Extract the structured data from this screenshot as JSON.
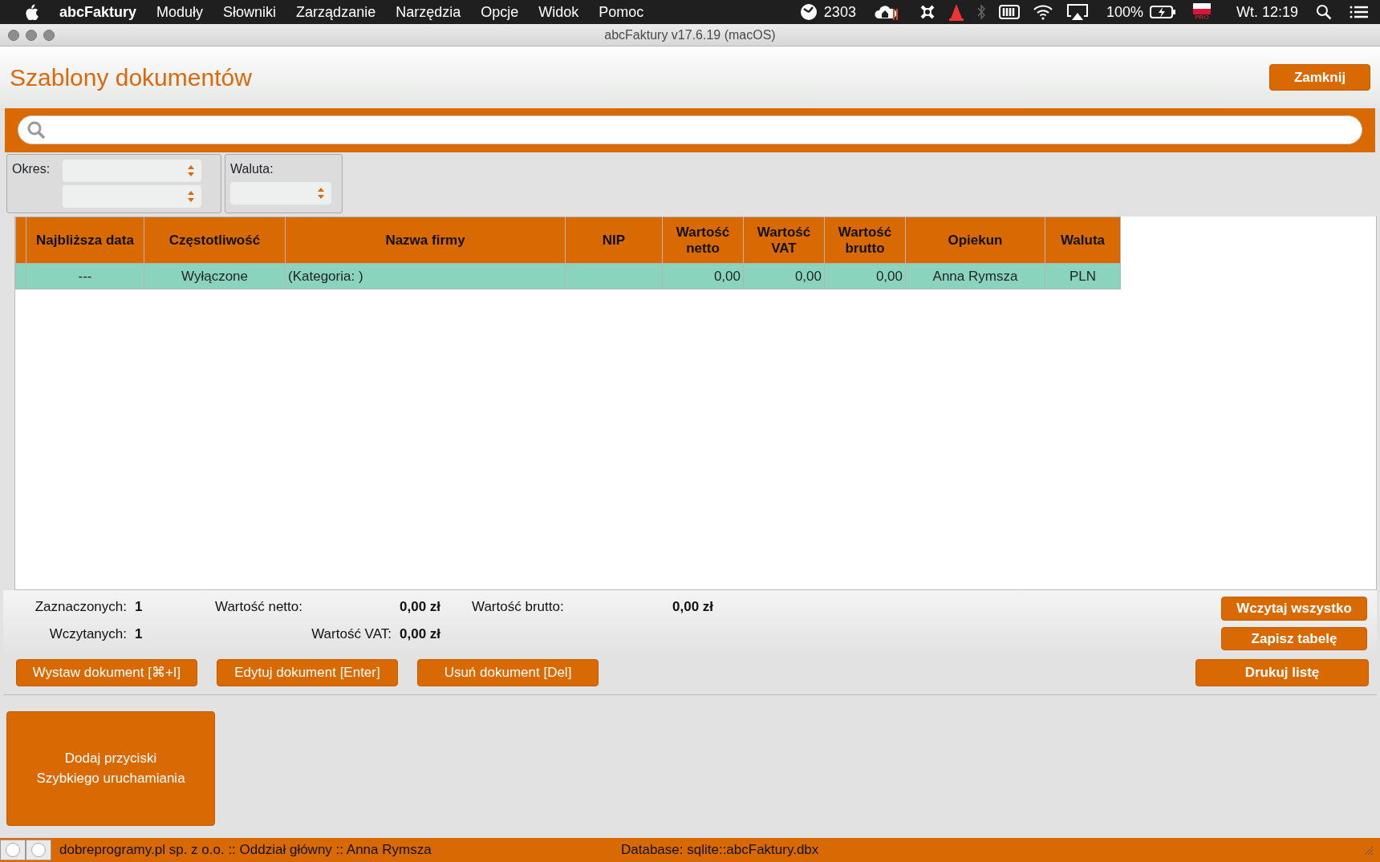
{
  "menu_bar": {
    "app_name": "abcFaktury",
    "items": [
      "Moduły",
      "Słowniki",
      "Zarządzanie",
      "Narzędzia",
      "Opcje",
      "Widok",
      "Pomoc"
    ],
    "timer_count": "2303",
    "flag_badge": "PRO",
    "battery": "100%",
    "clock": "Wt. 12:19"
  },
  "window": {
    "title": "abcFaktury v17.6.19 (macOS)"
  },
  "header": {
    "title": "Szablony dokumentów",
    "close_button": "Zamknij"
  },
  "filters": {
    "period_label": "Okres:",
    "currency_label": "Waluta:"
  },
  "table": {
    "columns": [
      "Najbliższa data",
      "Częstotliwość",
      "Nazwa firmy",
      "NIP",
      "Wartość netto",
      "Wartość VAT",
      "Wartość brutto",
      "Opiekun",
      "Waluta"
    ],
    "rows": [
      {
        "selected": true,
        "cells": [
          "---",
          "Wyłączone",
          "(Kategoria: )",
          "",
          "0,00",
          "0,00",
          "0,00",
          "Anna Rymsza",
          "PLN"
        ]
      }
    ]
  },
  "summary": [
    {
      "label": "Zaznaczonych:",
      "value": "1"
    },
    {
      "label": "Wczytanych:",
      "value": "1"
    },
    {
      "label": "Wartość netto:",
      "value": "0,00 zł"
    },
    {
      "label": "Wartość VAT:",
      "value": "0,00 zł"
    },
    {
      "label": "Wartość brutto:",
      "value": "0,00 zł"
    }
  ],
  "side_buttons": [
    "Wczytaj wszystko",
    "Zapisz tabelę"
  ],
  "actions": [
    "Wystaw dokument [⌘+I]",
    "Edytuj dokument [Enter]",
    "Usuń dokument [Del]"
  ],
  "print_button": "Drukuj listę",
  "quick_launch": {
    "line_1": "Dodaj przyciski",
    "line_2": "Szybkiego uruchamiania"
  },
  "status_bar": {
    "company": "dobreprogramy.pl sp. z o.o. :: Oddział główny :: Anna Rymsza",
    "database": "Database: sqlite::abcFaktury.dbx"
  }
}
